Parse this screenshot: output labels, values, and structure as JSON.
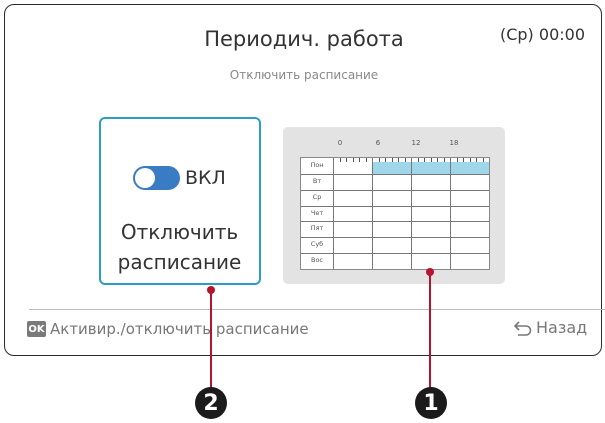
{
  "header": {
    "title": "Периодич. работа",
    "clock": "(Ср) 00:00",
    "subtitle": "Отключить расписание"
  },
  "toggle_card": {
    "state": "ВКЛ",
    "on": true,
    "label_line1": "Отключить",
    "label_line2": "расписание"
  },
  "schedule": {
    "hour_labels": [
      "0",
      "6",
      "12",
      "18"
    ],
    "days": [
      "Пон",
      "Вт",
      "Ср",
      "Чет",
      "Пят",
      "Суб",
      "Вос"
    ],
    "active_day": "Пон",
    "active_from_hour": 6,
    "active_to_hour": 24,
    "bar_color": "#9fd6ea"
  },
  "footer": {
    "ok_key": "OK",
    "hint": "Активир./отключить расписание",
    "back": "Назад"
  },
  "callouts": {
    "marker_1": "1",
    "marker_2": "2",
    "color": "#b8132d"
  }
}
